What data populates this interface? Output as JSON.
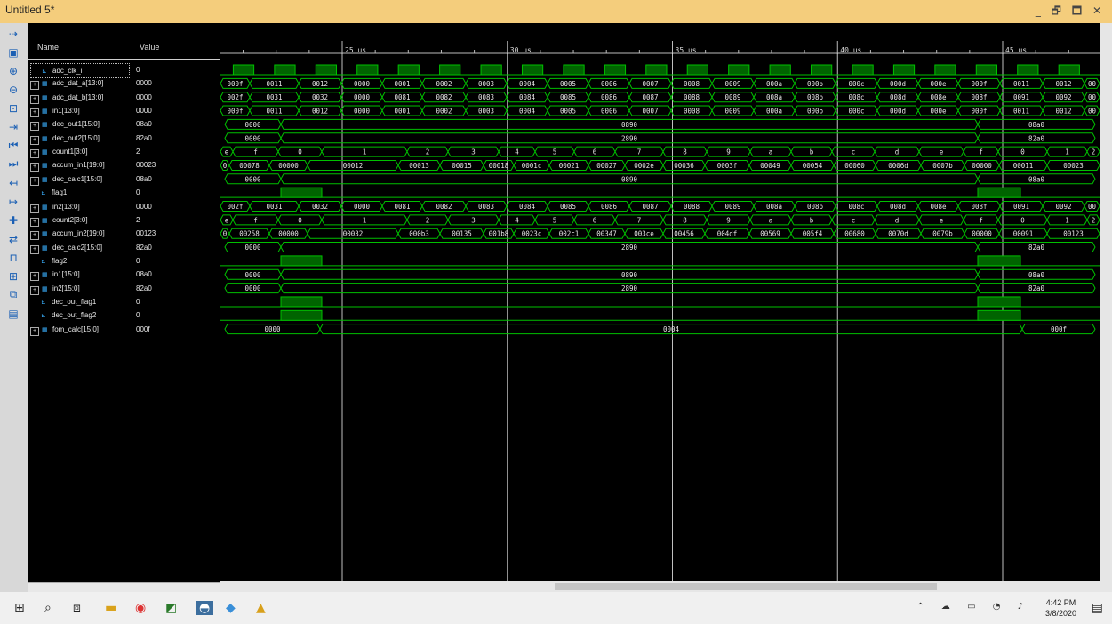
{
  "window": {
    "title": "Untitled 5*",
    "controls": "_ 🗗 🗖 ✕"
  },
  "columns": {
    "name": "Name",
    "value": "Value"
  },
  "signals": [
    {
      "name": "adc_clk_i",
      "value": "0",
      "bus": false
    },
    {
      "name": "adc_dat_a[13:0]",
      "value": "0000",
      "bus": true
    },
    {
      "name": "adc_dat_b[13:0]",
      "value": "0000",
      "bus": true
    },
    {
      "name": "in1[13:0]",
      "value": "0000",
      "bus": true
    },
    {
      "name": "dec_out1[15:0]",
      "value": "08a0",
      "bus": true
    },
    {
      "name": "dec_out2[15:0]",
      "value": "82a0",
      "bus": true
    },
    {
      "name": "count1[3:0]",
      "value": "2",
      "bus": true
    },
    {
      "name": "accum_in1[19:0]",
      "value": "00023",
      "bus": true
    },
    {
      "name": "dec_calc1[15:0]",
      "value": "08a0",
      "bus": true
    },
    {
      "name": "flag1",
      "value": "0",
      "bus": false
    },
    {
      "name": "in2[13:0]",
      "value": "0000",
      "bus": true
    },
    {
      "name": "count2[3:0]",
      "value": "2",
      "bus": true
    },
    {
      "name": "accum_in2[19:0]",
      "value": "00123",
      "bus": true
    },
    {
      "name": "dec_calc2[15:0]",
      "value": "82a0",
      "bus": true
    },
    {
      "name": "flag2",
      "value": "0",
      "bus": false
    },
    {
      "name": "in1[15:0]",
      "value": "08a0",
      "bus": true
    },
    {
      "name": "in2[15:0]",
      "value": "82a0",
      "bus": true
    },
    {
      "name": "dec_out_flag1",
      "value": "0",
      "bus": false
    },
    {
      "name": "dec_out_flag2",
      "value": "0",
      "bus": false
    },
    {
      "name": "fom_calc[15:0]",
      "value": "000f",
      "bus": true
    }
  ],
  "timeline": {
    "labels": [
      "25 us",
      "30 us",
      "35 us",
      "40 us",
      "45 us"
    ],
    "marker_times_us": [
      25,
      30,
      35,
      40,
      45
    ]
  },
  "waves": {
    "adc_dat_a": [
      "000f",
      "0011",
      "0012",
      "0000",
      "0001",
      "0002",
      "0003",
      "0004",
      "0005",
      "0006",
      "0007",
      "0008",
      "0009",
      "000a",
      "000b",
      "000c",
      "000d",
      "000e",
      "000f",
      "0011",
      "0012",
      "00"
    ],
    "adc_dat_b": [
      "002f",
      "0031",
      "0032",
      "0000",
      "0081",
      "0082",
      "0083",
      "0084",
      "0085",
      "0086",
      "0087",
      "0088",
      "0089",
      "008a",
      "008b",
      "008c",
      "008d",
      "008e",
      "008f",
      "0091",
      "0092",
      "00"
    ],
    "in1_13": [
      "000f",
      "0011",
      "0012",
      "0000",
      "0001",
      "0002",
      "0003",
      "0004",
      "0005",
      "0006",
      "0007",
      "0008",
      "0009",
      "000a",
      "000b",
      "000c",
      "000d",
      "000e",
      "000f",
      "0011",
      "0012",
      "00"
    ],
    "dec_out1": [
      "0000",
      "0890",
      "08a0"
    ],
    "dec_out2": [
      "0000",
      "2890",
      "82a0"
    ],
    "count1": [
      "e",
      "f",
      "0",
      "1",
      "2",
      "3",
      "4",
      "5",
      "6",
      "7",
      "8",
      "9",
      "a",
      "b",
      "c",
      "d",
      "e",
      "f",
      "0",
      "1",
      "2"
    ],
    "accum_in1": [
      "0",
      "00078",
      "00000",
      "00012",
      "00013",
      "00015",
      "00018",
      "0001c",
      "00021",
      "00027",
      "0002e",
      "00036",
      "0003f",
      "00049",
      "00054",
      "00060",
      "0006d",
      "0007b",
      "00000",
      "00011",
      "00023"
    ],
    "dec_calc1": [
      "0000",
      "0890",
      "08a0"
    ],
    "in2_13": [
      "002f",
      "0031",
      "0032",
      "0000",
      "0081",
      "0082",
      "0083",
      "0084",
      "0085",
      "0086",
      "0087",
      "0088",
      "0089",
      "008a",
      "008b",
      "008c",
      "008d",
      "008e",
      "008f",
      "0091",
      "0092",
      "00"
    ],
    "count2": [
      "e",
      "f",
      "0",
      "1",
      "2",
      "3",
      "4",
      "5",
      "6",
      "7",
      "8",
      "9",
      "a",
      "b",
      "c",
      "d",
      "e",
      "f",
      "0",
      "1",
      "2"
    ],
    "accum_in2": [
      "0",
      "00258",
      "00000",
      "00032",
      "000b3",
      "00135",
      "001b8",
      "0023c",
      "002c1",
      "00347",
      "003ce",
      "00456",
      "004df",
      "00569",
      "005f4",
      "00680",
      "0070d",
      "0079b",
      "00000",
      "00091",
      "00123"
    ],
    "dec_calc2": [
      "0000",
      "2890",
      "82a0"
    ],
    "in1_15": [
      "0000",
      "0890",
      "08a0"
    ],
    "in2_15": [
      "0000",
      "2890",
      "82a0"
    ],
    "fom_calc": [
      "0000",
      "0004",
      "000f"
    ]
  },
  "taskbar": {
    "time": "4:42 PM",
    "date": "3/8/2020",
    "notifications": "3"
  },
  "colors": {
    "wave": "#00c000",
    "waveFill": "#006400",
    "marker": "#ffffff",
    "titlebar": "#f4cd7c"
  }
}
